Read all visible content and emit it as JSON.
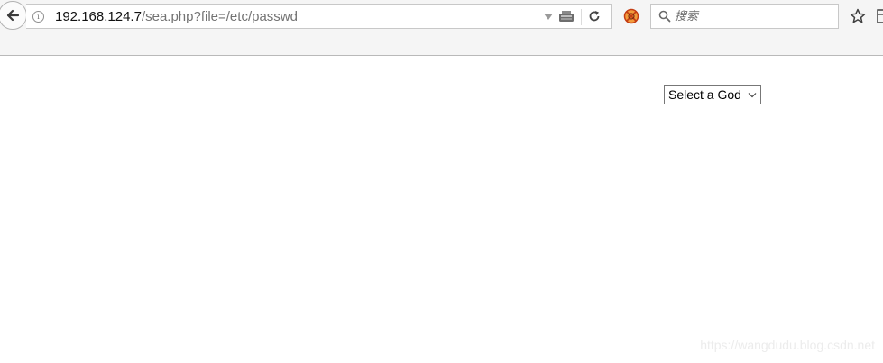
{
  "toolbar": {
    "back_icon": "arrow-left-icon",
    "info_icon": "info-icon",
    "url": {
      "host": "192.168.124.7",
      "path": "/sea.php?file=/etc/passwd"
    },
    "reload_icon": "reload-icon",
    "extension_icon": "addon-icon",
    "search": {
      "placeholder": "搜索",
      "icon": "search-icon"
    },
    "bookmark_icon": "star-icon"
  },
  "page": {
    "god_select": {
      "selected": "Select a God"
    }
  },
  "watermark": "https://wangdudu.blog.csdn.net"
}
